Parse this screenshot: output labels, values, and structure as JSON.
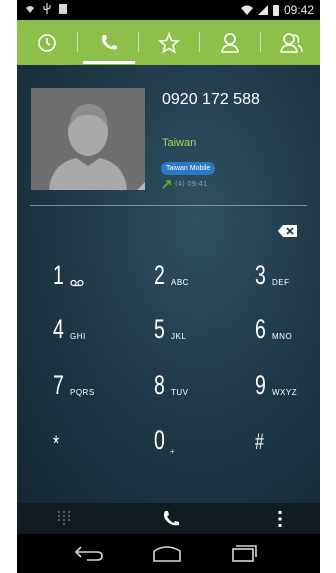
{
  "status_bar": {
    "time": "09:42"
  },
  "tabs": [
    {
      "name": "recent",
      "icon": "clock-icon",
      "active": false
    },
    {
      "name": "dialer",
      "icon": "phone-icon",
      "active": true
    },
    {
      "name": "favorites",
      "icon": "star-icon",
      "active": false
    },
    {
      "name": "contacts",
      "icon": "person-icon",
      "active": false
    },
    {
      "name": "groups",
      "icon": "people-icon",
      "active": false
    }
  ],
  "contact": {
    "number": "0920 172 588",
    "country": "Taiwan",
    "carrier": "Taiwan Mobile",
    "call_log": "(4) 09:41"
  },
  "dialer": {
    "digits": ""
  },
  "keypad": [
    {
      "num": "1",
      "letters": ""
    },
    {
      "num": "2",
      "letters": "ABC"
    },
    {
      "num": "3",
      "letters": "DEF"
    },
    {
      "num": "4",
      "letters": "GHI"
    },
    {
      "num": "5",
      "letters": "JKL"
    },
    {
      "num": "6",
      "letters": "MNO"
    },
    {
      "num": "7",
      "letters": "PQRS"
    },
    {
      "num": "8",
      "letters": "TUV"
    },
    {
      "num": "9",
      "letters": "WXYZ"
    },
    {
      "num": "*",
      "letters": ""
    },
    {
      "num": "0",
      "letters": "+"
    },
    {
      "num": "#",
      "letters": ""
    }
  ],
  "colors": {
    "tab_bar": "#8dc04a",
    "country": "#a6d45a",
    "carrier_badge": "#2a78c6",
    "call_icon": "#5fae3b"
  }
}
